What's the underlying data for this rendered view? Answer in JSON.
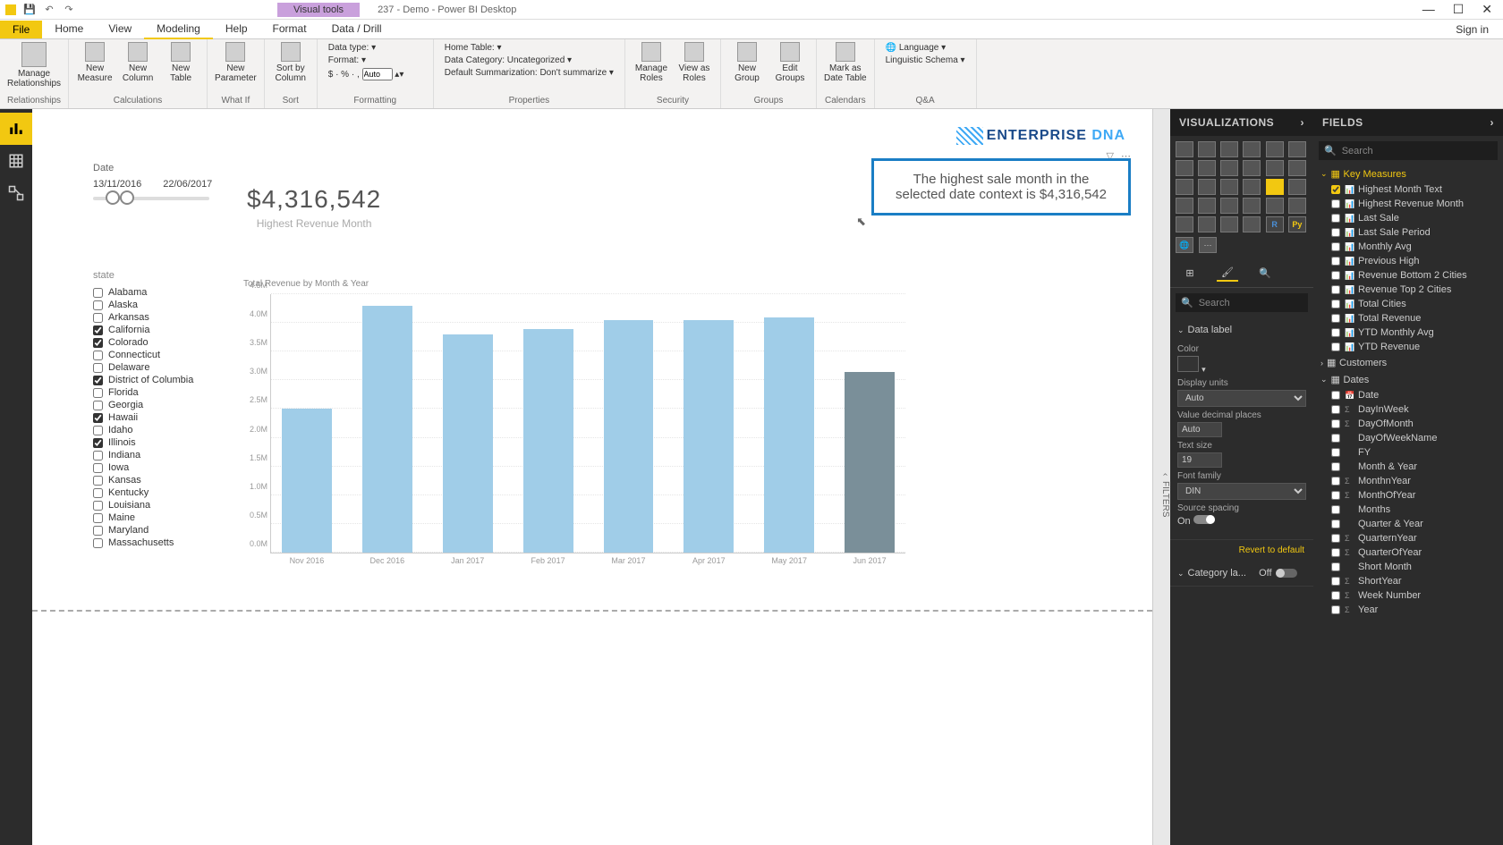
{
  "titlebar": {
    "visual_tools": "Visual tools",
    "title": "237 - Demo - Power BI Desktop"
  },
  "tabs": {
    "file": "File",
    "items": [
      "Home",
      "View",
      "Modeling",
      "Help",
      "Format",
      "Data / Drill"
    ],
    "active": "Modeling",
    "signin": "Sign in"
  },
  "ribbon": {
    "relationships": {
      "manage": "Manage\nRelationships",
      "group": "Relationships"
    },
    "calculations": {
      "measure": "New\nMeasure",
      "column": "New\nColumn",
      "table": "New\nTable",
      "group": "Calculations"
    },
    "whatif": {
      "param": "New\nParameter",
      "group": "What If"
    },
    "sort": {
      "sortby": "Sort by\nColumn",
      "group": "Sort"
    },
    "formatting": {
      "datatype": "Data type:",
      "format": "Format:",
      "auto": "Auto",
      "group": "Formatting"
    },
    "properties": {
      "hometable": "Home Table:",
      "datacat": "Data Category: Uncategorized",
      "summ": "Default Summarization: Don't summarize",
      "group": "Properties"
    },
    "security": {
      "manage": "Manage\nRoles",
      "viewas": "View as\nRoles",
      "group": "Security"
    },
    "groups": {
      "new": "New\nGroup",
      "edit": "Edit\nGroups",
      "group": "Groups"
    },
    "calendars": {
      "mark": "Mark as\nDate Table",
      "group": "Calendars"
    },
    "qa": {
      "lang": "Language",
      "schema": "Linguistic Schema",
      "group": "Q&A"
    }
  },
  "slicer": {
    "label": "Date",
    "from": "13/11/2016",
    "to": "22/06/2017"
  },
  "kpi": {
    "value": "$4,316,542",
    "label": "Highest Revenue Month"
  },
  "logo": {
    "text1": "ENTERPRISE ",
    "text2": "DNA"
  },
  "insight": "The highest sale month in the selected date context is $4,316,542",
  "states": {
    "label": "state",
    "items": [
      {
        "name": "Alabama",
        "checked": false
      },
      {
        "name": "Alaska",
        "checked": false
      },
      {
        "name": "Arkansas",
        "checked": false
      },
      {
        "name": "California",
        "checked": true
      },
      {
        "name": "Colorado",
        "checked": true
      },
      {
        "name": "Connecticut",
        "checked": false
      },
      {
        "name": "Delaware",
        "checked": false
      },
      {
        "name": "District of Columbia",
        "checked": true
      },
      {
        "name": "Florida",
        "checked": false
      },
      {
        "name": "Georgia",
        "checked": false
      },
      {
        "name": "Hawaii",
        "checked": true
      },
      {
        "name": "Idaho",
        "checked": false
      },
      {
        "name": "Illinois",
        "checked": true
      },
      {
        "name": "Indiana",
        "checked": false
      },
      {
        "name": "Iowa",
        "checked": false
      },
      {
        "name": "Kansas",
        "checked": false
      },
      {
        "name": "Kentucky",
        "checked": false
      },
      {
        "name": "Louisiana",
        "checked": false
      },
      {
        "name": "Maine",
        "checked": false
      },
      {
        "name": "Maryland",
        "checked": false
      },
      {
        "name": "Massachusetts",
        "checked": false
      }
    ]
  },
  "chart_data": {
    "type": "bar",
    "title": "Total Revenue by Month & Year",
    "categories": [
      "Nov 2016",
      "Dec 2016",
      "Jan 2017",
      "Feb 2017",
      "Mar 2017",
      "Apr 2017",
      "May 2017",
      "Jun 2017"
    ],
    "values": [
      2.5,
      4.3,
      3.8,
      3.9,
      4.05,
      4.05,
      4.1,
      3.15
    ],
    "highlighted_index": 7,
    "ylabel": "",
    "xlabel": "",
    "ylim": [
      0,
      4.5
    ],
    "yticks": [
      "0.0M",
      "0.5M",
      "1.0M",
      "1.5M",
      "2.0M",
      "2.5M",
      "3.0M",
      "3.5M",
      "4.0M",
      "4.5M"
    ]
  },
  "filters_tab": "FILTERS",
  "viz_pane": {
    "header": "VISUALIZATIONS",
    "search": "Search",
    "section_data_label": "Data label",
    "props": {
      "color": "Color",
      "display_units": "Display units",
      "display_units_val": "Auto",
      "decimal": "Value decimal places",
      "decimal_val": "Auto",
      "text_size": "Text size",
      "text_size_val": "19",
      "font": "Font family",
      "font_val": "DIN",
      "spacing": "Source spacing",
      "spacing_val": "On"
    },
    "revert": "Revert to default",
    "section_category": "Category la...",
    "category_val": "Off"
  },
  "fields_pane": {
    "header": "FIELDS",
    "search": "Search",
    "tables": [
      {
        "name": "Key Measures",
        "expanded": true,
        "fields": [
          {
            "name": "Highest Month Text",
            "icon": "fx",
            "checked": true
          },
          {
            "name": "Highest Revenue Month",
            "icon": "fx",
            "checked": false
          },
          {
            "name": "Last Sale",
            "icon": "fx",
            "checked": false
          },
          {
            "name": "Last Sale Period",
            "icon": "fx",
            "checked": false
          },
          {
            "name": "Monthly Avg",
            "icon": "fx",
            "checked": false
          },
          {
            "name": "Previous High",
            "icon": "fx",
            "checked": false
          },
          {
            "name": "Revenue Bottom 2 Cities",
            "icon": "fx",
            "checked": false
          },
          {
            "name": "Revenue Top 2 Cities",
            "icon": "fx",
            "checked": false
          },
          {
            "name": "Total Cities",
            "icon": "fx",
            "checked": false
          },
          {
            "name": "Total Revenue",
            "icon": "fx",
            "checked": false
          },
          {
            "name": "YTD Monthly Avg",
            "icon": "fx",
            "checked": false
          },
          {
            "name": "YTD Revenue",
            "icon": "fx",
            "checked": false
          }
        ]
      },
      {
        "name": "Customers",
        "expanded": false,
        "fields": []
      },
      {
        "name": "Dates",
        "expanded": true,
        "fields": [
          {
            "name": "Date",
            "icon": "cal",
            "checked": false
          },
          {
            "name": "DayInWeek",
            "icon": "Σ",
            "checked": false
          },
          {
            "name": "DayOfMonth",
            "icon": "Σ",
            "checked": false
          },
          {
            "name": "DayOfWeekName",
            "icon": "",
            "checked": false
          },
          {
            "name": "FY",
            "icon": "",
            "checked": false
          },
          {
            "name": "Month & Year",
            "icon": "",
            "checked": false
          },
          {
            "name": "MonthnYear",
            "icon": "Σ",
            "checked": false
          },
          {
            "name": "MonthOfYear",
            "icon": "Σ",
            "checked": false
          },
          {
            "name": "Months",
            "icon": "",
            "checked": false
          },
          {
            "name": "Quarter & Year",
            "icon": "",
            "checked": false
          },
          {
            "name": "QuarternYear",
            "icon": "Σ",
            "checked": false
          },
          {
            "name": "QuarterOfYear",
            "icon": "Σ",
            "checked": false
          },
          {
            "name": "Short Month",
            "icon": "",
            "checked": false
          },
          {
            "name": "ShortYear",
            "icon": "Σ",
            "checked": false
          },
          {
            "name": "Week Number",
            "icon": "Σ",
            "checked": false
          },
          {
            "name": "Year",
            "icon": "Σ",
            "checked": false
          }
        ]
      }
    ]
  }
}
